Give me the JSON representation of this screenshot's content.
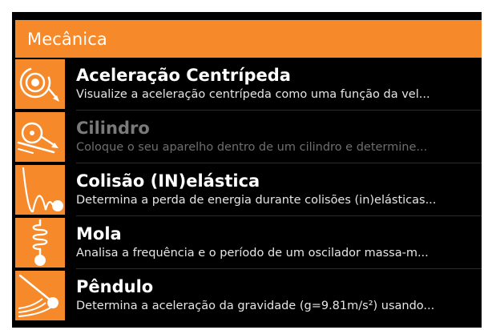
{
  "section": {
    "title": "Mecânica"
  },
  "colors": {
    "accent": "#f68a2b",
    "background": "#000000",
    "text": "#ffffff",
    "disabled_text": "#7a7a7a"
  },
  "items": [
    {
      "title": "Aceleração Centrípeda",
      "subtitle": "Visualize a aceleração centrípeda como uma função da vel...",
      "icon": "centripetal-icon",
      "enabled": true
    },
    {
      "title": "Cilindro",
      "subtitle": "Coloque o seu aparelho dentro de um cilindro e determine...",
      "icon": "cylinder-icon",
      "enabled": false
    },
    {
      "title": "Colisão (IN)elástica",
      "subtitle": "Determina a perda de energia durante colisões (in)elásticas...",
      "icon": "bouncing-ball-icon",
      "enabled": true
    },
    {
      "title": "Mola",
      "subtitle": "Analisa a frequência e o período de um oscilador massa-m...",
      "icon": "spring-icon",
      "enabled": true
    },
    {
      "title": "Pêndulo",
      "subtitle": "Determina a aceleração da gravidade (g=9.81m/s²) usando...",
      "icon": "pendulum-icon",
      "enabled": true
    }
  ]
}
